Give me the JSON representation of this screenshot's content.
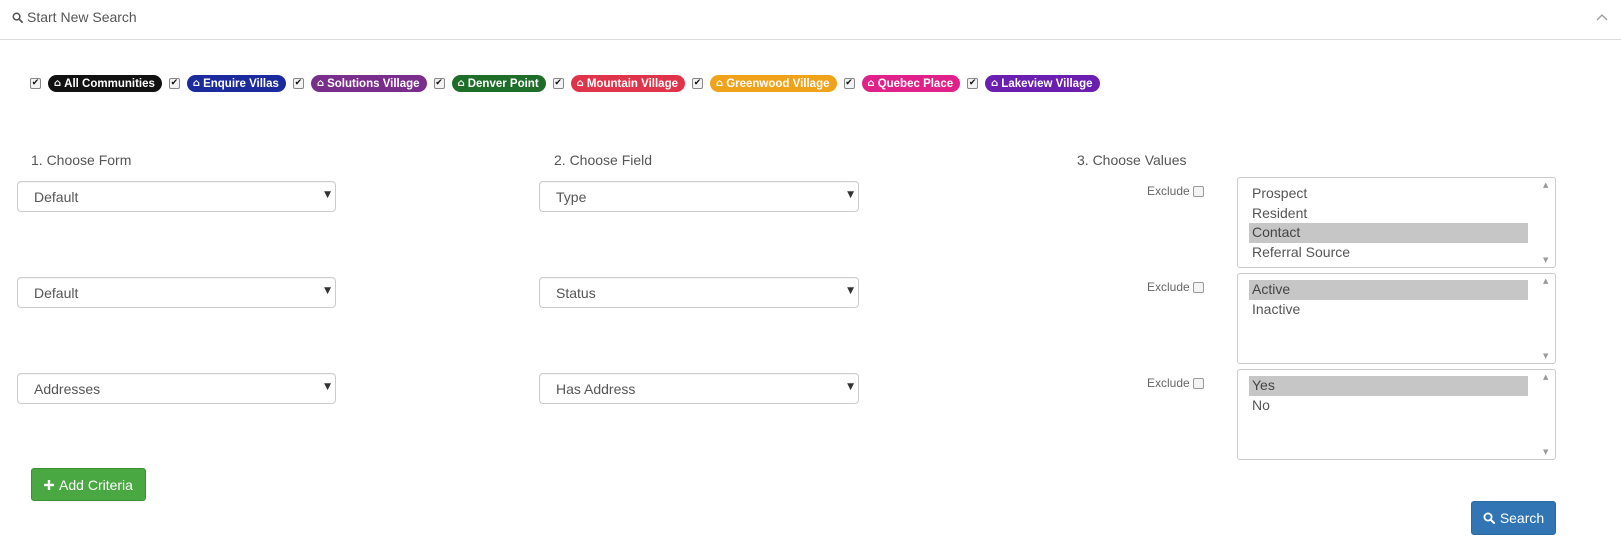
{
  "header": {
    "title": "Start New Search",
    "search_icon": "search-icon",
    "collapse_icon": "chevron-up-icon"
  },
  "communities": [
    {
      "label": "All Communities",
      "color": "#111111",
      "checked": true
    },
    {
      "label": "Enquire Villas",
      "color": "#1b2a9c",
      "checked": true
    },
    {
      "label": "Solutions Village",
      "color": "#7a2e8c",
      "checked": true
    },
    {
      "label": "Denver Point",
      "color": "#1e6e2a",
      "checked": true
    },
    {
      "label": "Mountain Village",
      "color": "#e0344a",
      "checked": true
    },
    {
      "label": "Greenwood Village",
      "color": "#f0a21a",
      "checked": true
    },
    {
      "label": "Quebec Place",
      "color": "#e0218a",
      "checked": true
    },
    {
      "label": "Lakeview Village",
      "color": "#6a1fb0",
      "checked": true
    }
  ],
  "columns": {
    "form": "1. Choose Form",
    "field": "2. Choose Field",
    "values": "3. Choose Values"
  },
  "criteria": [
    {
      "form": "Default",
      "field": "Type",
      "exclude_label": "Exclude",
      "exclude_checked": false,
      "values": [
        {
          "label": "Prospect",
          "selected": false
        },
        {
          "label": "Resident",
          "selected": false
        },
        {
          "label": "Contact",
          "selected": true
        },
        {
          "label": "Referral Source",
          "selected": false
        }
      ]
    },
    {
      "form": "Default",
      "field": "Status",
      "exclude_label": "Exclude",
      "exclude_checked": false,
      "values": [
        {
          "label": "Active",
          "selected": true
        },
        {
          "label": "Inactive",
          "selected": false
        }
      ]
    },
    {
      "form": "Addresses",
      "field": "Has Address",
      "exclude_label": "Exclude",
      "exclude_checked": false,
      "values": [
        {
          "label": "Yes",
          "selected": true
        },
        {
          "label": "No",
          "selected": false
        }
      ]
    }
  ],
  "buttons": {
    "add_criteria": "Add Criteria",
    "add_icon": "plus-icon",
    "search": "Search",
    "search_icon": "search-icon"
  },
  "colors": {
    "add_button": "#4aa843",
    "search_button": "#3175b4",
    "selected_option": "#c6c6c6"
  }
}
